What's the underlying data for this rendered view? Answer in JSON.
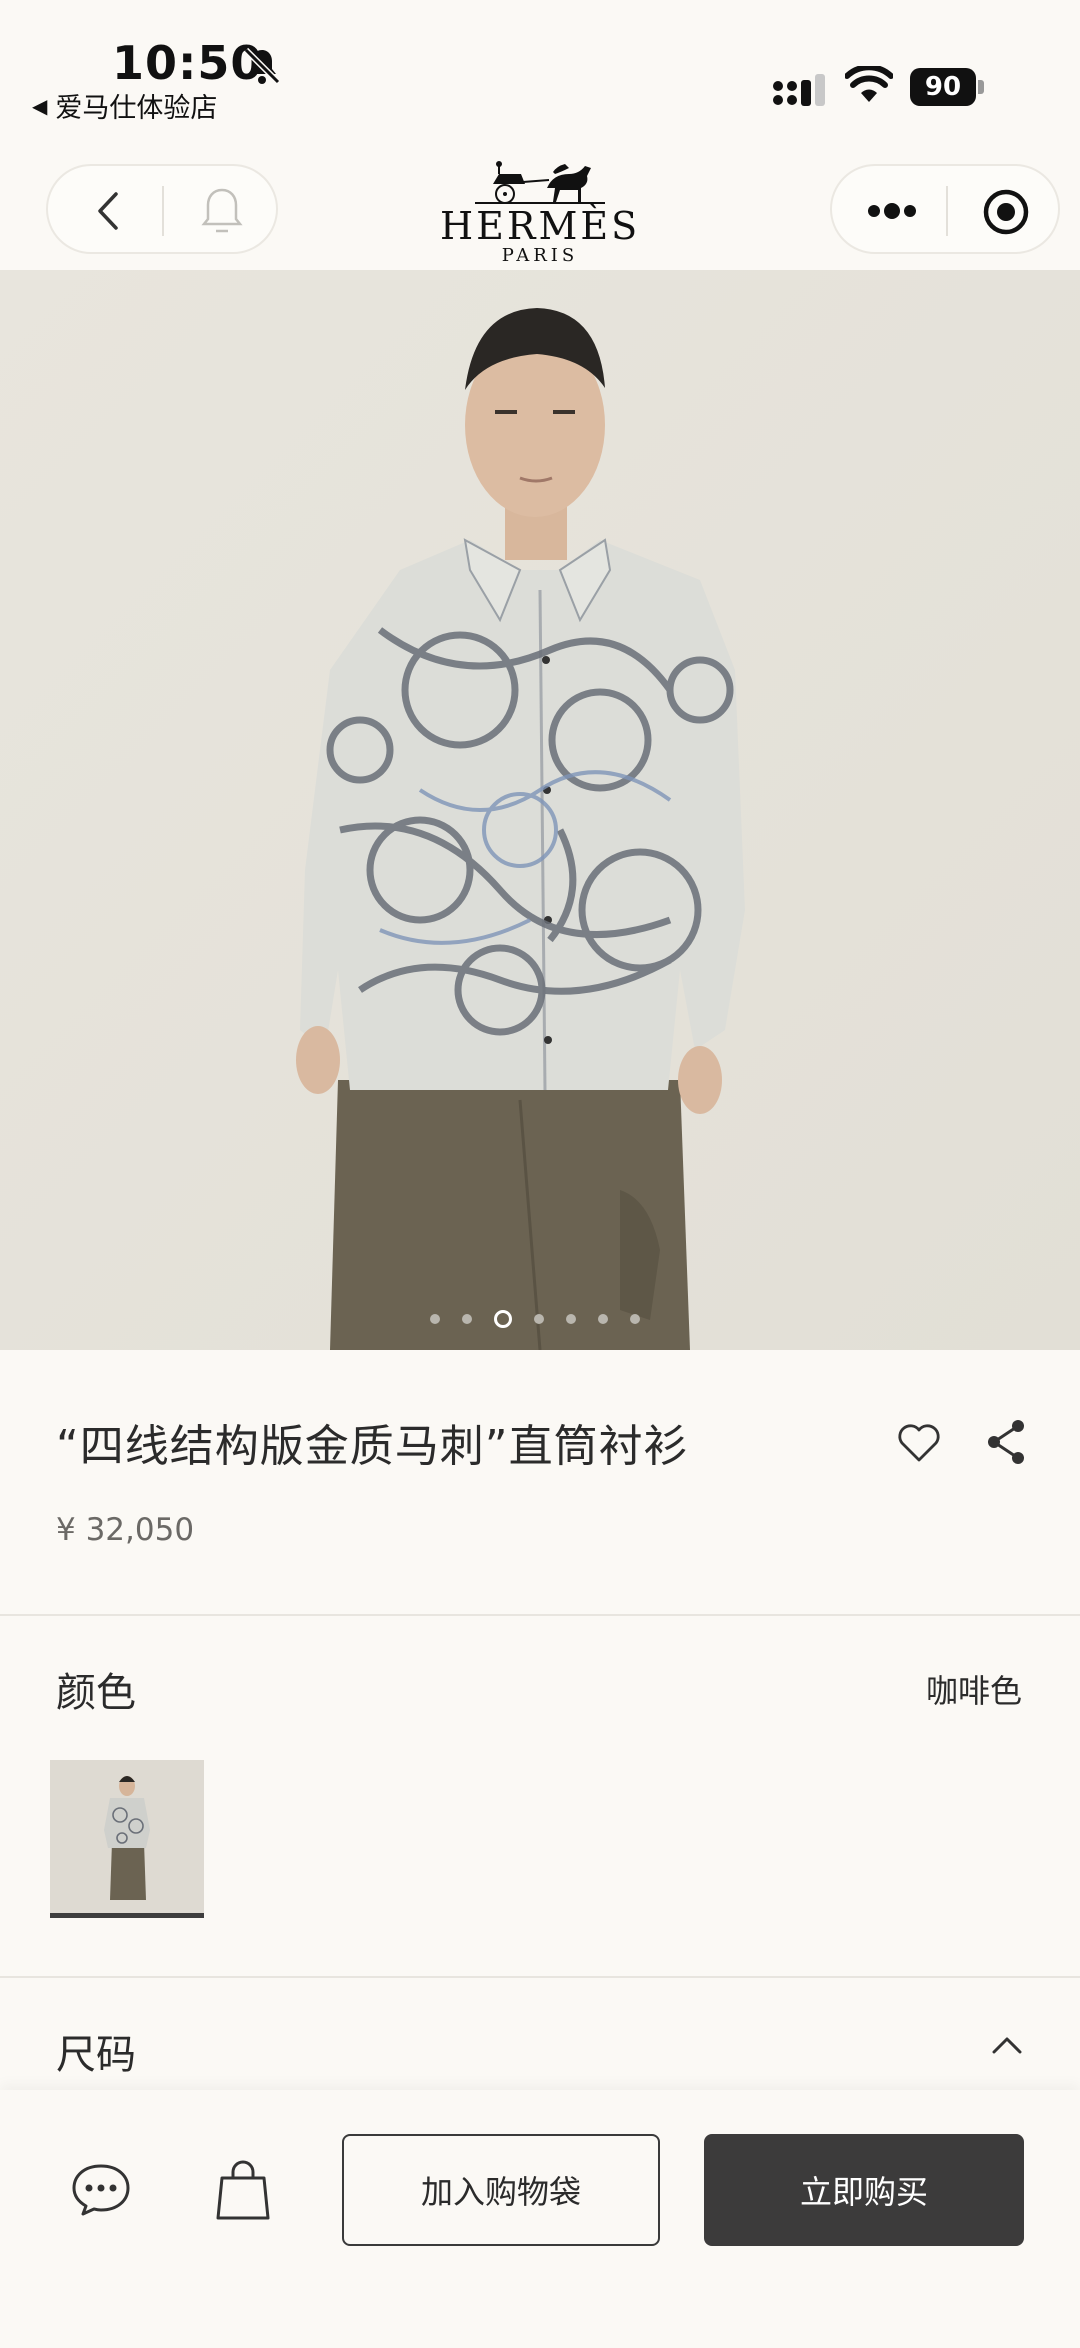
{
  "status_bar": {
    "time": "10:50",
    "back_app": "爱马仕体验店",
    "battery": "90"
  },
  "brand": {
    "name": "HERMÈS",
    "city": "PARIS"
  },
  "carousel": {
    "total": 7,
    "active_index": 3
  },
  "product": {
    "title": "“四线结构版金质马刺”直筒衬衫",
    "price": "¥ 32,050"
  },
  "color_section": {
    "label": "颜色",
    "selected": "咖啡色"
  },
  "size_section": {
    "label": "尺码"
  },
  "actions": {
    "add_to_bag": "加入购物袋",
    "buy_now": "立即购买"
  },
  "colors": {
    "background": "#fbf9f5",
    "buy_button": "#3c3b3b"
  }
}
